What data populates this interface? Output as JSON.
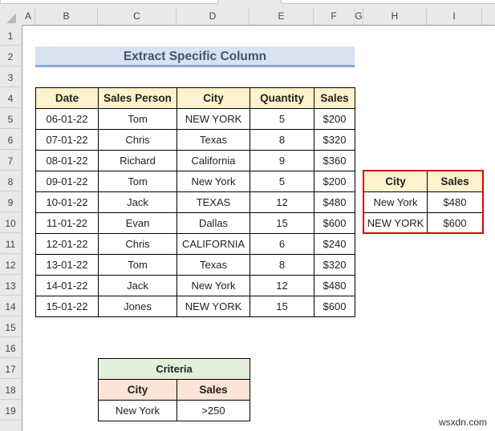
{
  "columns": [
    "A",
    "B",
    "C",
    "D",
    "E",
    "F",
    "G",
    "H",
    "I"
  ],
  "rows": [
    "1",
    "2",
    "3",
    "4",
    "5",
    "6",
    "7",
    "8",
    "9",
    "10",
    "11",
    "12",
    "13",
    "14",
    "15",
    "16",
    "17",
    "18",
    "19"
  ],
  "title": "Extract Specific Column",
  "main_table": {
    "headers": [
      "Date",
      "Sales Person",
      "City",
      "Quantity",
      "Sales"
    ],
    "rows": [
      [
        "06-01-22",
        "Tom",
        "NEW YORK",
        "5",
        "$200"
      ],
      [
        "07-01-22",
        "Chris",
        "Texas",
        "8",
        "$320"
      ],
      [
        "08-01-22",
        "Richard",
        "California",
        "9",
        "$360"
      ],
      [
        "09-01-22",
        "Tom",
        "New York",
        "5",
        "$200"
      ],
      [
        "10-01-22",
        "Jack",
        "TEXAS",
        "12",
        "$480"
      ],
      [
        "11-01-22",
        "Evan",
        "Dallas",
        "15",
        "$600"
      ],
      [
        "12-01-22",
        "Chris",
        "CALIFORNIA",
        "6",
        "$240"
      ],
      [
        "13-01-22",
        "Tom",
        "Texas",
        "8",
        "$320"
      ],
      [
        "14-01-22",
        "Jack",
        "New York",
        "12",
        "$480"
      ],
      [
        "15-01-22",
        "Jones",
        "NEW YORK",
        "15",
        "$600"
      ]
    ]
  },
  "result_table": {
    "headers": [
      "City",
      "Sales"
    ],
    "rows": [
      [
        "New York",
        "$480"
      ],
      [
        "NEW YORK",
        "$600"
      ]
    ]
  },
  "criteria": {
    "title": "Criteria",
    "headers": [
      "City",
      "Sales"
    ],
    "values": [
      "New York",
      ">250"
    ]
  },
  "watermark": "wsxdn.com"
}
